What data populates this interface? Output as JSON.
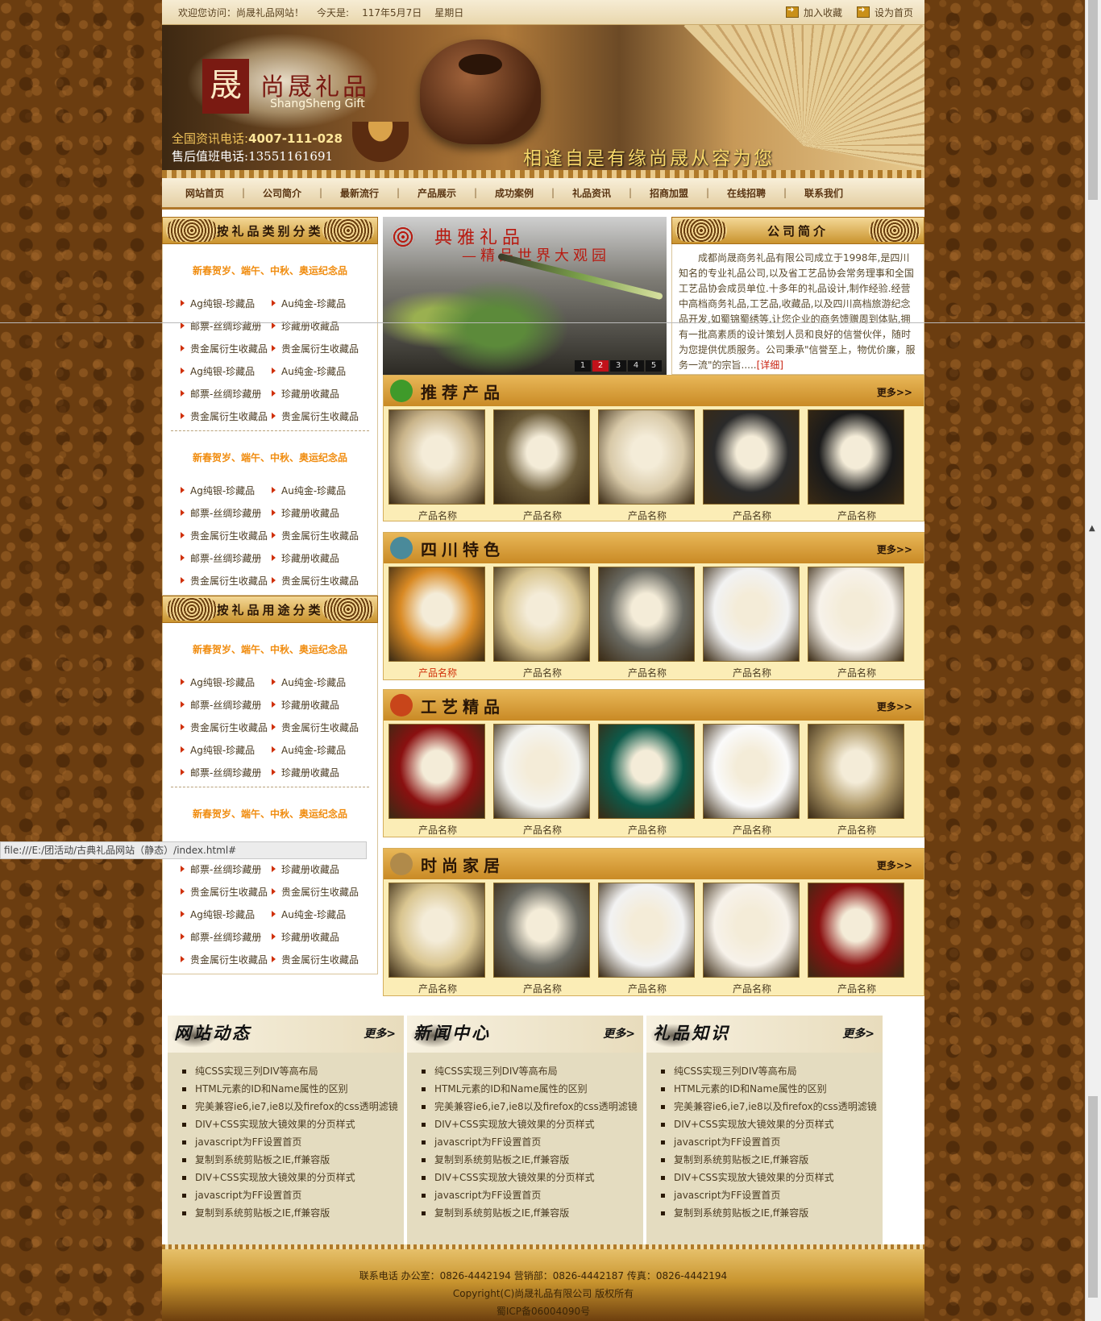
{
  "topbar": {
    "welcome": "欢迎您访问：尚晟礼品网站！",
    "date_label": "今天是:",
    "date": "117年5月7日",
    "weekday": "星期日",
    "favorite": "加入收藏",
    "homepage": "设为首页"
  },
  "banner": {
    "logo_seal": "晟",
    "logo_cn": "尚晟礼品",
    "logo_en": "ShangSheng Gift",
    "hotline_label": "全国资讯电话:",
    "hotline": "4007-111-028",
    "service_label": "售后值班电话:",
    "service": "13551161691",
    "slogan": "相逢自是有缘尚晟从容为您"
  },
  "nav": [
    "网站首页",
    "公司简介",
    "最新流行",
    "产品展示",
    "成功案例",
    "礼品资讯",
    "招商加盟",
    "在线招聘",
    "联系我们"
  ],
  "left": {
    "title1": "按礼品类别分类",
    "title2": "按礼品用途分类",
    "group_head": "新春贺岁、端午、中秋、奥运纪念品",
    "groups1": [
      {
        "rows": [
          [
            "Ag纯银-珍藏品",
            "Au纯金-珍藏品"
          ],
          [
            "邮票-丝绸珍藏册",
            "珍藏册收藏品"
          ],
          [
            "贵金属衍生收藏品",
            "贵金属衍生收藏品"
          ],
          [
            "Ag纯银-珍藏品",
            "Au纯金-珍藏品"
          ],
          [
            "邮票-丝绸珍藏册",
            "珍藏册收藏品"
          ],
          [
            "贵金属衍生收藏品",
            "贵金属衍生收藏品"
          ]
        ]
      },
      {
        "rows": [
          [
            "Ag纯银-珍藏品",
            "Au纯金-珍藏品"
          ],
          [
            "邮票-丝绸珍藏册",
            "珍藏册收藏品"
          ],
          [
            "贵金属衍生收藏品",
            "贵金属衍生收藏品"
          ],
          [
            "邮票-丝绸珍藏册",
            "珍藏册收藏品"
          ],
          [
            "贵金属衍生收藏品",
            "贵金属衍生收藏品"
          ]
        ]
      }
    ],
    "groups2": [
      {
        "rows": [
          [
            "Ag纯银-珍藏品",
            "Au纯金-珍藏品"
          ],
          [
            "邮票-丝绸珍藏册",
            "珍藏册收藏品"
          ],
          [
            "贵金属衍生收藏品",
            "贵金属衍生收藏品"
          ],
          [
            "Ag纯银-珍藏品",
            "Au纯金-珍藏品"
          ],
          [
            "邮票-丝绸珍藏册",
            "珍藏册收藏品"
          ]
        ]
      },
      {
        "rows": [
          [
            "Ag纯银-珍藏品",
            "Au纯金-珍藏品"
          ],
          [
            "邮票-丝绸珍藏册",
            "珍藏册收藏品"
          ],
          [
            "贵金属衍生收藏品",
            "贵金属衍生收藏品"
          ],
          [
            "Ag纯银-珍藏品",
            "Au纯金-珍藏品"
          ],
          [
            "邮票-丝绸珍藏册",
            "珍藏册收藏品"
          ],
          [
            "贵金属衍生收藏品",
            "贵金属衍生收藏品"
          ]
        ]
      }
    ]
  },
  "slider": {
    "title1": "典雅礼品",
    "title2": "—精品世界大观园",
    "pages": [
      "1",
      "2",
      "3",
      "4",
      "5"
    ],
    "active_page": "2"
  },
  "intro": {
    "title": "公司简介",
    "text": "成都尚晟商务礼品有限公司成立于1998年,是四川知名的专业礼品公司,以及省工艺品协会常务理事和全国工艺品协会成员单位.十多年的礼品设计,制作经验.经营中高档商务礼品,工艺品,收藏品,以及四川高档旅游纪念品开发,如蜀锦蜀绣等.让您企业的商务馈赠周到体贴,拥有一批高素质的设计策划人员和良好的信誉伙伴，随时为您提供优质服务。公司秉承\"信誉至上，物优价廉，服务一流\"的宗旨.....",
    "more": "[详细]"
  },
  "sections": [
    {
      "title": "推荐产品",
      "more": "更多>>",
      "icon_color": "#3f9a2a",
      "products": [
        "产品名称",
        "产品名称",
        "产品名称",
        "产品名称",
        "产品名称"
      ]
    },
    {
      "title": "四川特色",
      "more": "更多>>",
      "icon_color": "#4a8a9a",
      "products": [
        "产品名称",
        "产品名称",
        "产品名称",
        "产品名称",
        "产品名称"
      ]
    },
    {
      "title": "工艺精品",
      "more": "更多>>",
      "icon_color": "#c8451a",
      "products": [
        "产品名称",
        "产品名称",
        "产品名称",
        "产品名称",
        "产品名称"
      ]
    },
    {
      "title": "时尚家居",
      "more": "更多>>",
      "icon_color": "#b08a4a",
      "products": [
        "产品名称",
        "产品名称",
        "产品名称",
        "产品名称",
        "产品名称"
      ]
    }
  ],
  "news": [
    {
      "title": "网站动态",
      "more": "更多>"
    },
    {
      "title": "新闻中心",
      "more": "更多>"
    },
    {
      "title": "礼品知识",
      "more": "更多>"
    }
  ],
  "news_items": [
    "纯CSS实现三列DIV等高布局",
    "HTML元素的ID和Name属性的区别",
    "完美兼容ie6,ie7,ie8以及firefox的css透明滤镜",
    "DIV+CSS实现放大镜效果的分页样式",
    "javascript为FF设置首页",
    "复制到系统剪贴板之IE,ff兼容版",
    "DIV+CSS实现放大镜效果的分页样式",
    "javascript为FF设置首页",
    "复制到系统剪贴板之IE,ff兼容版"
  ],
  "footer": {
    "contact": "联系电话 办公室：0826-4442194 营销部：0826-4442187 传真：0826-4442194",
    "copyright": "Copyright(C)尚晟礼品有限公司 版权所有",
    "icp": "蜀ICP备06004090号"
  },
  "browser": {
    "status_url": "file:///E:/团活动/古典礼品网站（静态）/index.html#"
  }
}
